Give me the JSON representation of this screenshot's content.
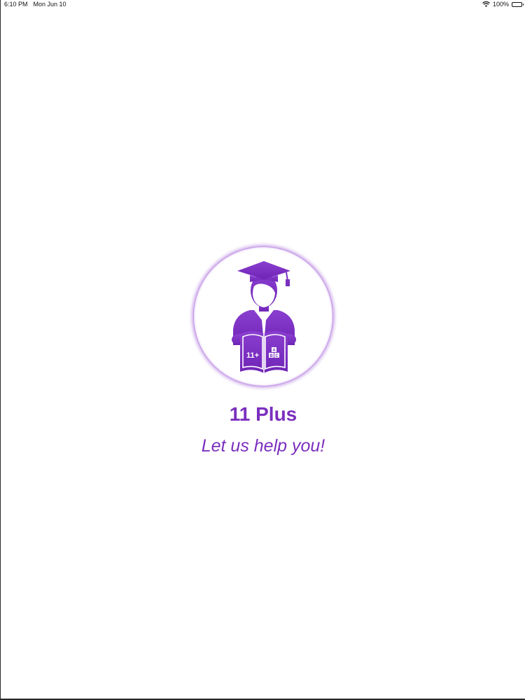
{
  "status_bar": {
    "time": "6:10 PM",
    "date": "Mon Jun 10",
    "battery": "100%"
  },
  "logo": {
    "book_left_text": "11+",
    "book_right_letters": [
      "A",
      "B",
      "C"
    ],
    "icon": "graduate-reading-icon"
  },
  "app": {
    "title": "11 Plus",
    "tagline": "Let us help you!"
  },
  "colors": {
    "brand": "#7b2fbe",
    "brand_light": "#a05ad8"
  }
}
